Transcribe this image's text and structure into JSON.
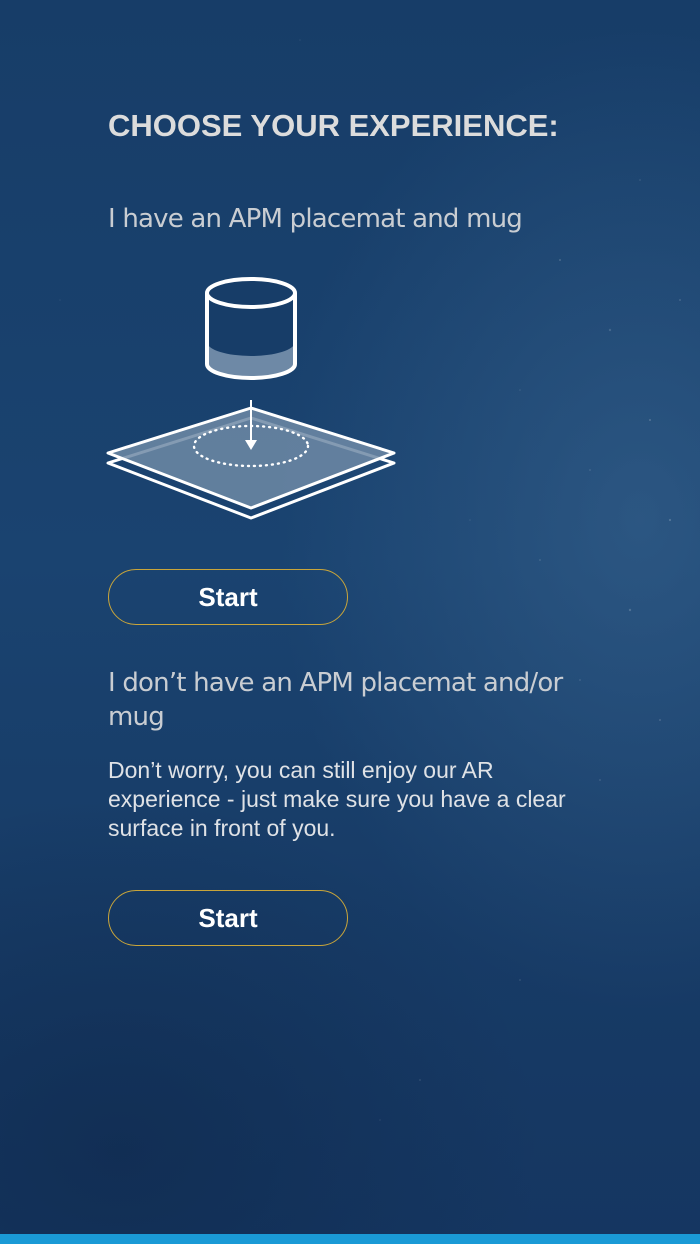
{
  "page": {
    "title": "CHOOSE YOUR EXPERIENCE:"
  },
  "option_with_placemat": {
    "heading": "I have an APM placemat and mug",
    "illustration_icon": "mug-on-placemat-icon",
    "start_label": "Start"
  },
  "option_without_placemat": {
    "heading": "I don’t have an APM placemat and/or mug",
    "description": "Don’t worry, you can still enjoy our AR experience - just make sure you have a clear surface in front of you.",
    "start_label": "Start"
  },
  "colors": {
    "background": "#173d68",
    "button_border": "#c9a53a",
    "bottom_bar": "#1a9ad6",
    "text_light": "#dcdcdc"
  }
}
